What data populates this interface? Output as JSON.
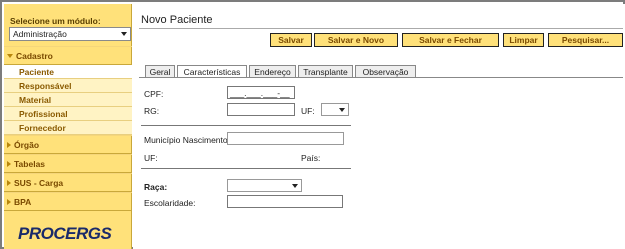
{
  "sidebar": {
    "module_label": "Selecione um módulo:",
    "module_value": "Administração",
    "items": [
      {
        "label": "Cadastro",
        "open": true
      },
      {
        "label": "Órgão"
      },
      {
        "label": "Tabelas"
      },
      {
        "label": "SUS - Carga"
      },
      {
        "label": "BPA"
      }
    ],
    "subitems": [
      "Paciente",
      "Responsável",
      "Material",
      "Profissional",
      "Fornecedor"
    ],
    "logo": "PROCERGS"
  },
  "header": {
    "title": "Novo Paciente"
  },
  "toolbar": {
    "save": "Salvar",
    "save_new": "Salvar e Novo",
    "save_close": "Salvar e Fechar",
    "clear": "Limpar",
    "search": "Pesquisar..."
  },
  "tabs": [
    "Geral",
    "Características",
    "Endereço",
    "Transplante",
    "Observação"
  ],
  "form": {
    "cpf_label": "CPF:",
    "cpf_value": "___.___.___-__",
    "rg_label": "RG:",
    "uf_label": "UF:",
    "municipio_label": "Município Nascimento:",
    "uf2_label": "UF:",
    "pais_label": "País:",
    "raca_label": "Raça:",
    "escolaridade_label": "Escolaridade:"
  }
}
